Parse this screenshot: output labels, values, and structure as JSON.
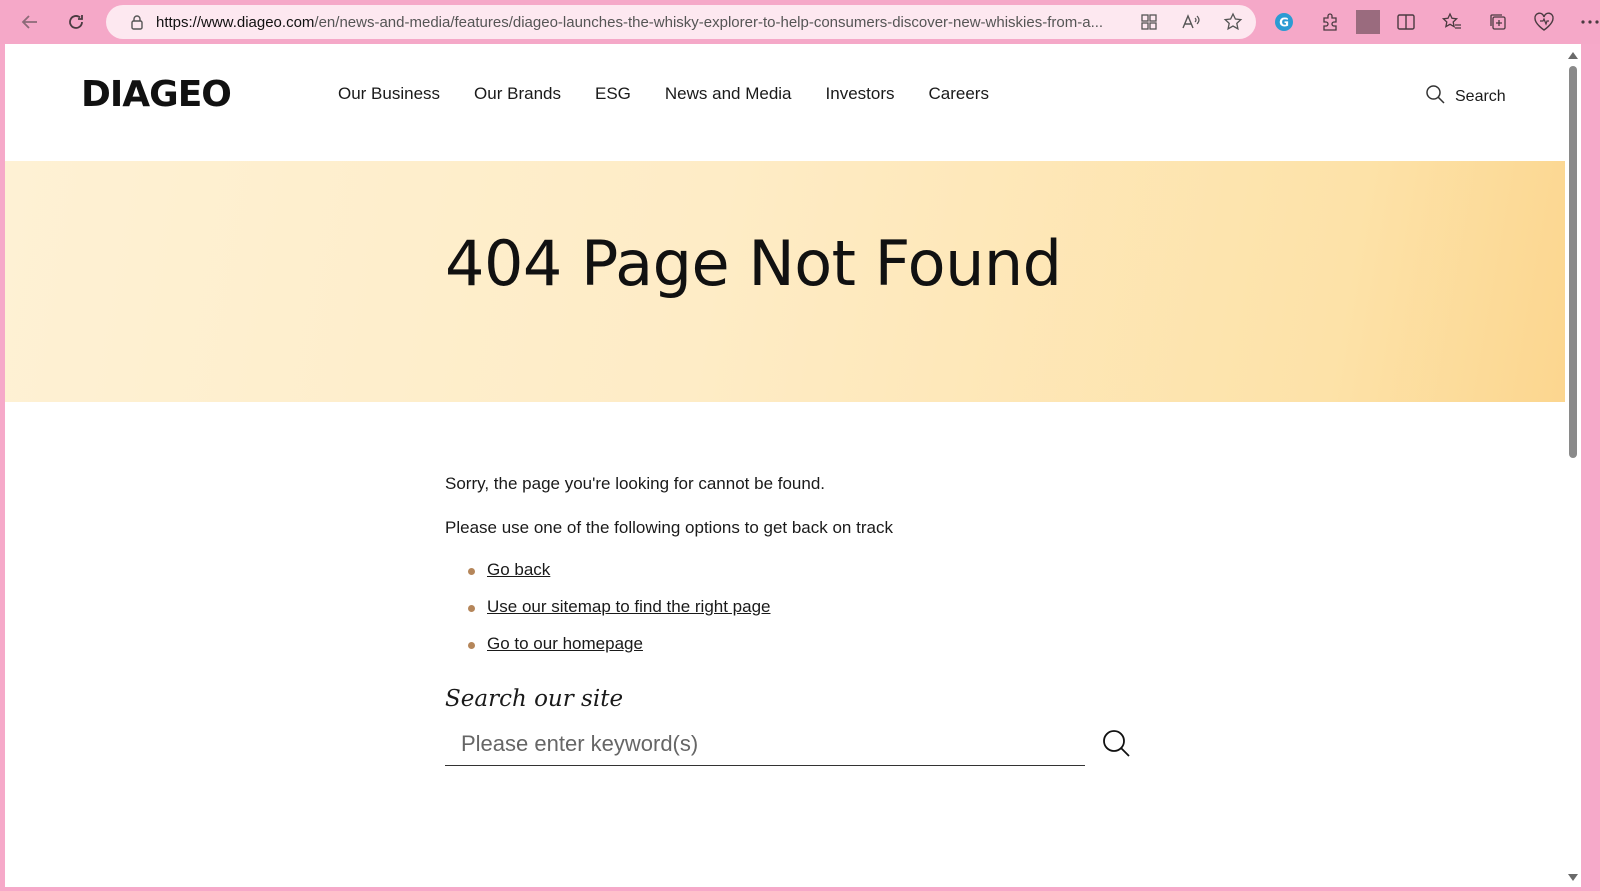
{
  "browser": {
    "url_host": "https://www.diageo.com",
    "url_rest": "/en/news-and-media/features/diageo-launches-the-whisky-explorer-to-help-consumers-discover-new-whiskies-from-a...",
    "icons": [
      "back-icon",
      "refresh-icon",
      "lock-icon",
      "app-available-icon",
      "read-aloud-icon",
      "favorite-star-icon",
      "grammarly-icon",
      "extensions-icon",
      "split-screen-icon",
      "favorites-icon",
      "collections-icon",
      "browser-essentials-icon",
      "more-menu-icon"
    ]
  },
  "header": {
    "logo": "DIAGEO",
    "nav": [
      "Our Business",
      "Our Brands",
      "ESG",
      "News and Media",
      "Investors",
      "Careers"
    ],
    "search_label": "Search"
  },
  "hero": {
    "title": "404 Page Not Found"
  },
  "content": {
    "sorry_text": "Sorry, the page you're looking for cannot be found.",
    "options_text": "Please use one of the following options to get back on track",
    "links": [
      "Go back",
      "Use our sitemap to find the right page",
      "Go to our homepage"
    ],
    "search_heading": "Search our site",
    "search_placeholder": "Please enter keyword(s)"
  },
  "colors": {
    "browser_frame": "#f5a8c8",
    "hero_gradient_start": "#fef1d4",
    "hero_gradient_end": "#fcd68f",
    "bullet": "#b5865a"
  }
}
